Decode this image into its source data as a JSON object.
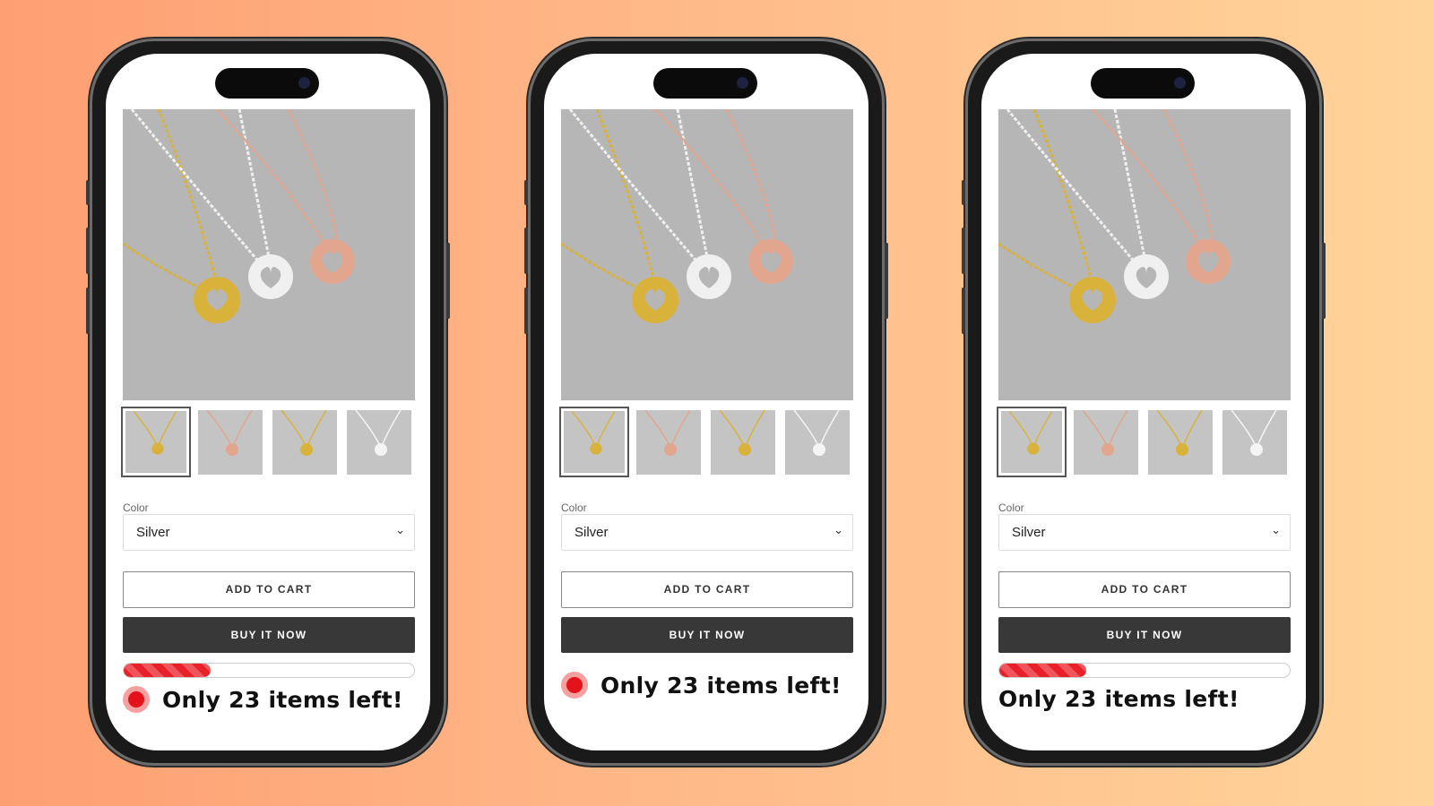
{
  "phones": [
    {
      "color_label": "Color",
      "color_value": "Silver",
      "add_to_cart": "ADD TO CART",
      "buy_now": "BUY IT NOW",
      "stock_text": "Only 23 items left!",
      "progress_percent": 30,
      "show_progress": true,
      "show_dot": true
    },
    {
      "color_label": "Color",
      "color_value": "Silver",
      "add_to_cart": "ADD TO CART",
      "buy_now": "BUY IT NOW",
      "stock_text": "Only 23 items left!",
      "show_progress": false,
      "show_dot": true
    },
    {
      "color_label": "Color",
      "color_value": "Silver",
      "add_to_cart": "ADD TO CART",
      "buy_now": "BUY IT NOW",
      "stock_text": "Only 23 items left!",
      "progress_percent": 30,
      "show_progress": true,
      "show_dot": false
    }
  ],
  "icons": {
    "dropdown": "chevron-down-icon",
    "status": "red-dot-icon"
  },
  "colors": {
    "accent_red": "#e4121b",
    "buy_button": "#383838",
    "gold": "#d9b23c",
    "silver": "#e8e8e8",
    "rose": "#e0a48c"
  }
}
